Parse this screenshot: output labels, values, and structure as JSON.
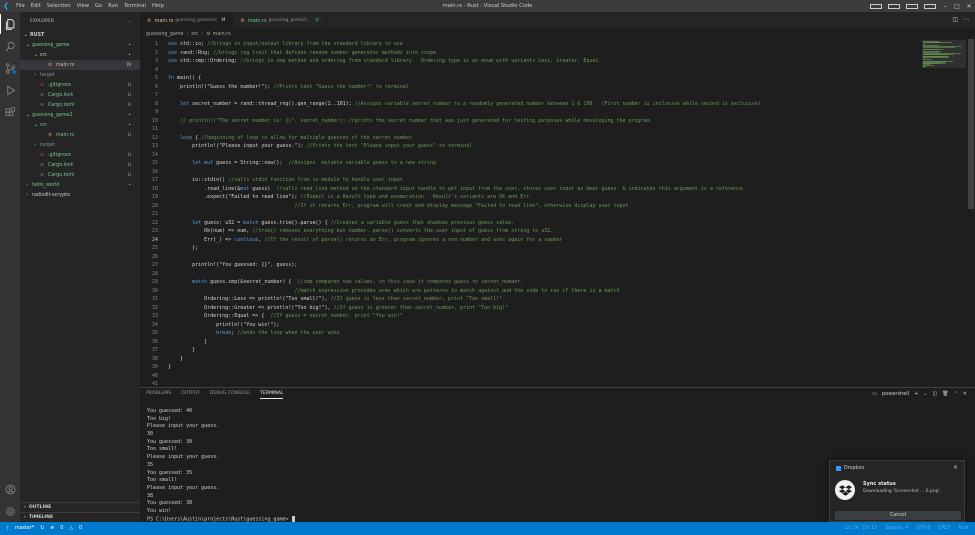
{
  "colors": {
    "accent": "#007acc",
    "comment": "#6a9955",
    "keyword": "#569cd6",
    "added": "#73c991",
    "modified": "#e2c08d"
  },
  "titlebar": {
    "menu": [
      "File",
      "Edit",
      "Selection",
      "View",
      "Go",
      "Run",
      "Terminal",
      "Help"
    ],
    "title": "main.rs - Rust - Visual Studio Code"
  },
  "activity": [
    "explorer-icon",
    "search-icon",
    "source-control-icon",
    "run-debug-icon",
    "extensions-icon",
    "account-icon",
    "settings-gear-icon"
  ],
  "sidebar": {
    "header": "EXPLORER",
    "more": "…",
    "workspace": "RUST",
    "tree": [
      {
        "label": "guessing_game",
        "depth": 0,
        "kind": "folder-open",
        "status": "•",
        "color": "green"
      },
      {
        "label": "src",
        "depth": 1,
        "kind": "folder-open",
        "status": "•",
        "color": "mod"
      },
      {
        "label": "main.rs",
        "depth": 2,
        "kind": "rust",
        "status": "M",
        "color": "mod",
        "selected": true
      },
      {
        "label": "target",
        "depth": 1,
        "kind": "folder",
        "status": "",
        "color": "gray"
      },
      {
        "label": ".gitignore",
        "depth": 1,
        "kind": "file",
        "status": "U",
        "color": "green"
      },
      {
        "label": "Cargo.lock",
        "depth": 1,
        "kind": "file",
        "status": "U",
        "color": "green"
      },
      {
        "label": "Cargo.toml",
        "depth": 1,
        "kind": "file",
        "status": "U",
        "color": "green"
      },
      {
        "label": "guessing_game2",
        "depth": 0,
        "kind": "folder-open",
        "status": "•",
        "color": "green"
      },
      {
        "label": "src",
        "depth": 1,
        "kind": "folder-open",
        "status": "•",
        "color": "green"
      },
      {
        "label": "main.rs",
        "depth": 2,
        "kind": "rust",
        "status": "U",
        "color": "green"
      },
      {
        "label": "target",
        "depth": 1,
        "kind": "folder",
        "status": "",
        "color": "gray"
      },
      {
        "label": ".gitignore",
        "depth": 1,
        "kind": "file",
        "status": "U",
        "color": "green"
      },
      {
        "label": "Cargo.lock",
        "depth": 1,
        "kind": "file",
        "status": "U",
        "color": "green"
      },
      {
        "label": "Cargo.toml",
        "depth": 1,
        "kind": "file",
        "status": "U",
        "color": "green"
      },
      {
        "label": "hello_world",
        "depth": 0,
        "kind": "folder",
        "status": "•",
        "color": "green"
      },
      {
        "label": "radixdlt-scrypto",
        "depth": 0,
        "kind": "folder",
        "status": "",
        "color": "plain"
      }
    ],
    "outline": "OUTLINE",
    "timeline": "TIMELINE"
  },
  "tabs": [
    {
      "name": "main.rs",
      "desc": "guessing_game\\src",
      "state": "M",
      "active": true
    },
    {
      "name": "main.rs",
      "desc": "guessing_game2\\...",
      "state": "U",
      "active": false
    }
  ],
  "breadcrumb": [
    "guessing_game",
    "src",
    "main.rs"
  ],
  "code": [
    "use std::io; //brings in input/output library from the standard library to use",
    "use rand::Rng; //brings rng trait that defines random number generator methods into scope",
    "use std::cmp::Ordering; //brings in cmp method and ordering from standard library.  Ordering type is an enum with variants Less, Greater, Equal.",
    "",
    "fn main() {",
    "    println!(\"Guess the number!\"); //Prints text \"Guess the number!\" to terminal",
    "",
    "    let secret_number = rand::thread_rng().gen_range(1..101); //Assigns variable secret_number to a randomly generated number between 1 & 100.  (First number is inclusive while second is exclusive)",
    "",
    "    // println!(\"The secret number is: {}\", secret_number); //prints the secret number that was just generated for testing purposes while developing the program",
    "",
    "    loop { //beginning of loop to allow for multiple guesses of the secret number",
    "        println!(\"Please input your guess.\"); //Prints the text \"Please input your guess\" to terminal",
    "",
    "        let mut guess = String::new();  //Assigns  mutable variable guess to a new string",
    "",
    "        io::stdin() //calls stdin function from io module to handle user input",
    "            .read_line(&mut guess)  //calls read_line method on the standard input handle to get input from the user, stores user input as &mut guess. & indicates this argument is a reference",
    "            .expect(\"Failed to read line\"); //Expect is a Result type and enumeration.  Result's variants are Ok and Err.",
    "                                          //If it returns Err, program will crash and display message \"Failed to read line\", otherwise display user input",
    "",
    "        let guess: u32 = match guess.trim().parse() { //Creates a variable guess that shadows previous guess value.",
    "            Ok(num) => num, //trim() removes everything but number. parse() converts the user input of guess from string to u32.",
    "            Err(_) => continue, //If the result of parse() returns an Err, program ignores a non number and asks again for a number",
    "        };",
    "",
    "        println!(\"You guessed: {}\", guess);",
    "",
    "        match guess.cmp(&secret_number) {  //cmp compares two values, in this case it compares guess to secret_number.",
    "                                          //match expression provides arms which are patterns to match against and the code to run if there is a match",
    "            Ordering::Less => println!(\"Too small!\"), //If guess is less than secret_number, print \"Too small!\"",
    "            Ordering::Greater => println!(\"Too big!\"), //If guess is greater than secret_number, print \"Too big!\"",
    "            Ordering::Equal => {  //If guess = secret_number, print \"You win!\"",
    "                println!(\"You win!\");",
    "                break; //ends the loop when the user wins",
    "            }",
    "        }",
    "    }",
    "}",
    "",
    ""
  ],
  "current_line": 24,
  "panel": {
    "tabs": [
      "PROBLEMS",
      "OUTPUT",
      "DEBUG CONSOLE",
      "TERMINAL"
    ],
    "active_tab": "TERMINAL",
    "shell": "powershell",
    "terminal": [
      "You guessed: 40",
      "Too big!",
      "Please input your guess.",
      "30",
      "You guessed: 30",
      "Too small!",
      "Please input your guess.",
      "35",
      "You guessed: 35",
      "Too small!",
      "Please input your guess.",
      "38",
      "You guessed: 38",
      "You win!",
      "PS C:\\Users\\Austin\\projects\\Rust\\guessing_game> "
    ]
  },
  "notification": {
    "source": "Dropbox",
    "title": "Sync status",
    "body": "Downloading 'Screenshot ... 6.png'.",
    "button": "Cancel"
  },
  "statusbar": {
    "branch": "master*",
    "errors": "0",
    "warnings": "0",
    "right": [
      "Ln 24, Col 13",
      "Spaces: 4",
      "UTF-8",
      "CRLF",
      "Rust"
    ]
  }
}
